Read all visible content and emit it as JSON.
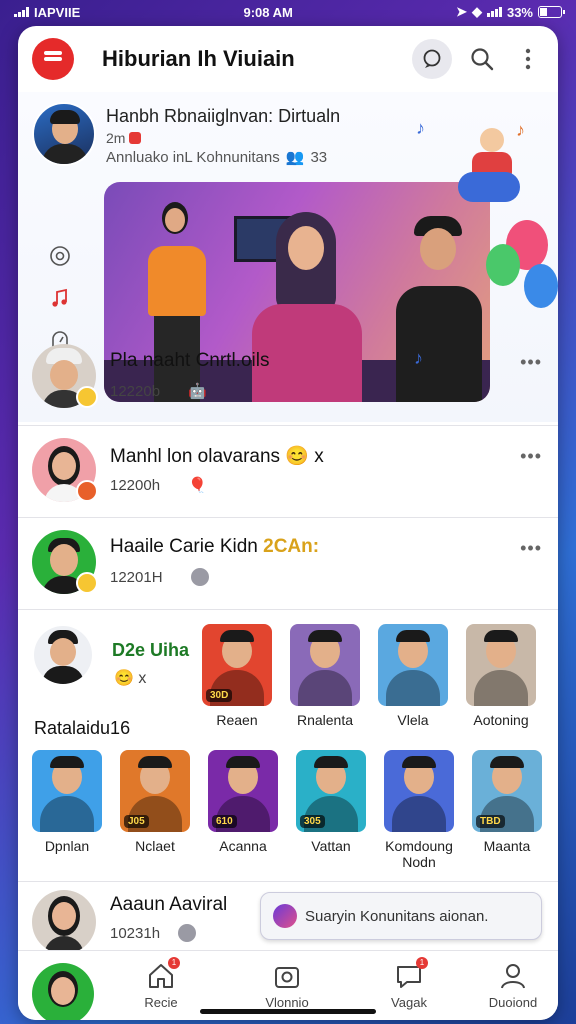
{
  "status": {
    "carrier": "IAPVIIE",
    "time": "9:08 AM",
    "battery": "33%"
  },
  "header": {
    "title": "Hiburian Ih Viuiain"
  },
  "featured": {
    "title": "Hanbh Rbnaiiglnvan: Dirtualn",
    "meta": "2m",
    "community": "Annluako inL Kohnunitans",
    "community_count": "33"
  },
  "feed": [
    {
      "name": "Pla naaht Cnrtl.oils",
      "time": "12220b"
    },
    {
      "name": "Manhl lon olavarans",
      "suffix": "x",
      "time": "12200h"
    },
    {
      "name": "Haaile Carie Kidn",
      "tag": "2CAn:",
      "time": "12201H"
    }
  ],
  "grid": {
    "title": "D2e Uiha",
    "subtitle": "x",
    "section_title": "Ratalaidu16",
    "row1": [
      {
        "label": "Reaen",
        "count": "30D",
        "color": "#e2452f"
      },
      {
        "label": "Rnalenta",
        "count": "",
        "color": "#8a6ab8"
      },
      {
        "label": "Vlela",
        "count": "",
        "color": "#5aa8e0"
      },
      {
        "label": "Aotoning",
        "count": "",
        "color": "#c8b8a8"
      }
    ],
    "row2": [
      {
        "label": "Dpnlan",
        "count": "",
        "color": "#3fa0e8"
      },
      {
        "label": "Nclaet",
        "count": "J05",
        "color": "#e0782a"
      },
      {
        "label": "Acanna",
        "count": "610",
        "color": "#7a2aa8"
      },
      {
        "label": "Vattan",
        "count": "305",
        "color": "#2ab0c8"
      },
      {
        "label": "Komdoung Nodn",
        "count": "",
        "color": "#4a6ad8"
      },
      {
        "label": "Maanta",
        "count": "TBD",
        "color": "#6ab0d8"
      }
    ]
  },
  "lastrow": {
    "name": "Aaaun Aaviral",
    "time": "10231h"
  },
  "join_button": "Suaryin Konunitans aionan.",
  "nav": [
    {
      "label": "Recie",
      "badge": "1"
    },
    {
      "label": "Vlonnio",
      "badge": ""
    },
    {
      "label": "Vagak",
      "badge": "1"
    },
    {
      "label": "Duoiond",
      "badge": ""
    }
  ]
}
